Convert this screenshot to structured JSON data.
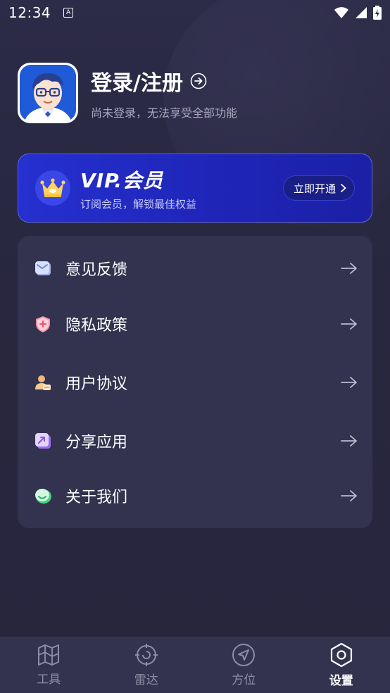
{
  "status_bar": {
    "time": "12:34",
    "notification_letter": "A"
  },
  "profile": {
    "title": "登录/注册",
    "subtitle": "尚未登录，无法享受全部功能"
  },
  "vip": {
    "title": "VIP.会员",
    "subtitle": "订阅会员，解锁最佳权益",
    "button": "立即开通"
  },
  "menu": [
    {
      "label": "意见反馈",
      "icon": "feedback-icon"
    },
    {
      "label": "隐私政策",
      "icon": "privacy-shield-icon"
    },
    {
      "label": "用户协议",
      "icon": "user-agreement-icon"
    },
    {
      "label": "分享应用",
      "icon": "share-icon"
    },
    {
      "label": "关于我们",
      "icon": "about-icon"
    }
  ],
  "nav": [
    {
      "label": "工具",
      "icon": "tools-map-icon",
      "active": false
    },
    {
      "label": "雷达",
      "icon": "radar-icon",
      "active": false
    },
    {
      "label": "方位",
      "icon": "direction-icon",
      "active": false
    },
    {
      "label": "设置",
      "icon": "settings-hex-icon",
      "active": true
    }
  ],
  "colors": {
    "background": "#272640",
    "card": "#33324f",
    "vip_blue": "#2530cf",
    "nav_bg": "#34334f",
    "inactive_text": "#8e8da6"
  }
}
